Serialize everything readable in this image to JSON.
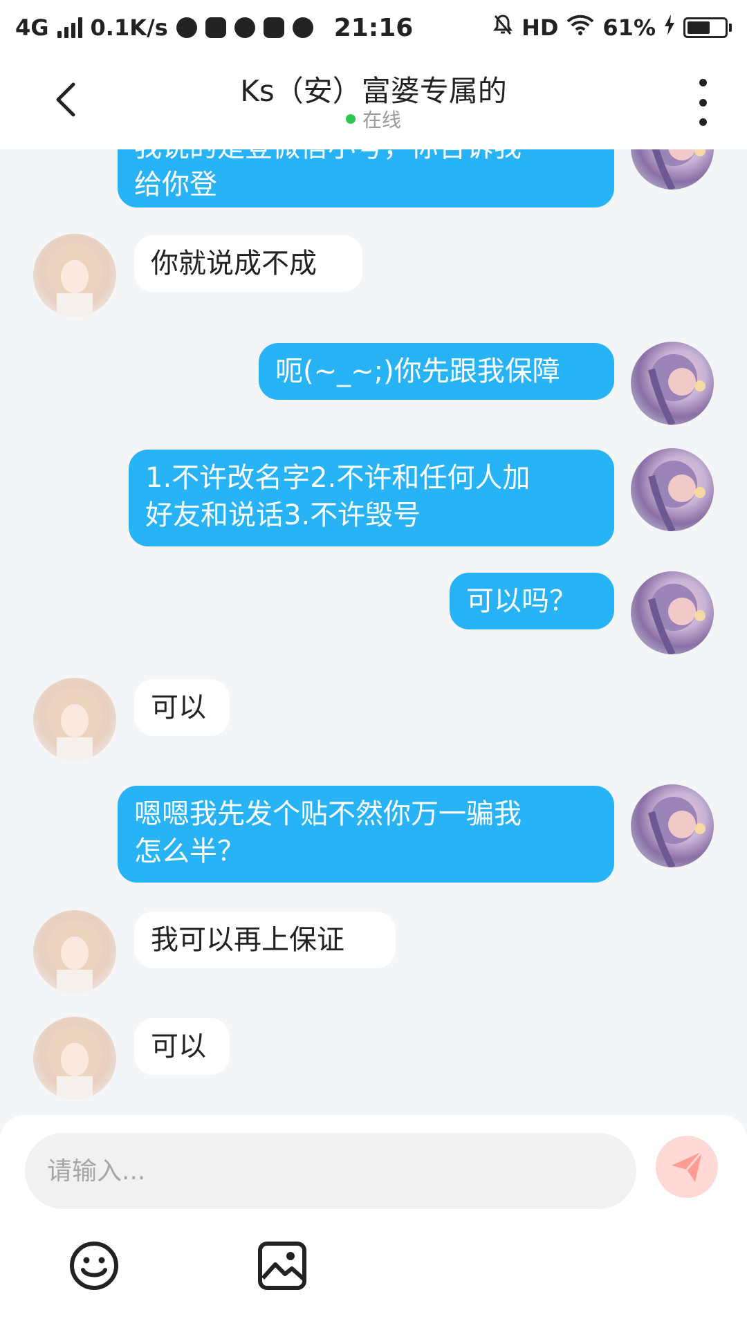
{
  "status_bar": {
    "network": "4G",
    "speed": "0.1K/s",
    "time": "21:16",
    "hd": "HD",
    "battery": "61%",
    "battery_level": 0.61
  },
  "header": {
    "title": "Ks（安）富婆专属的",
    "status": "在线",
    "status_color": "#2dc84d"
  },
  "messages": [
    {
      "side": "out",
      "text_lines": [
        "我说的是登微信小号，你告诉我",
        "给你登"
      ]
    },
    {
      "side": "in",
      "text_lines": [
        "你就说成不成"
      ]
    },
    {
      "side": "out",
      "text_lines": [
        "呃(~_~;)你先跟我保障"
      ]
    },
    {
      "side": "out",
      "text_lines": [
        "1.不许改名字2.不许和任何人加",
        "好友和说话3.不许毁号"
      ]
    },
    {
      "side": "out",
      "text_lines": [
        "可以吗？"
      ]
    },
    {
      "side": "in",
      "text_lines": [
        "可以"
      ]
    },
    {
      "side": "out",
      "text_lines": [
        "嗯嗯我先发个贴不然你万一骗我",
        "怎么半？"
      ]
    },
    {
      "side": "in",
      "text_lines": [
        "我可以再上保证"
      ]
    },
    {
      "side": "in",
      "text_lines": [
        "可以"
      ]
    }
  ],
  "input": {
    "placeholder": "请输入...",
    "value": ""
  },
  "colors": {
    "outgoing_bubble": "#27b3f6",
    "incoming_bubble": "#ffffff",
    "send_button": "#ffd9d6",
    "send_icon": "#ff8d84"
  },
  "icons": {
    "back": "chevron-left-icon",
    "more": "more-vertical-icon",
    "send": "paper-plane-icon",
    "emoji": "emoji-icon",
    "image": "image-icon"
  }
}
